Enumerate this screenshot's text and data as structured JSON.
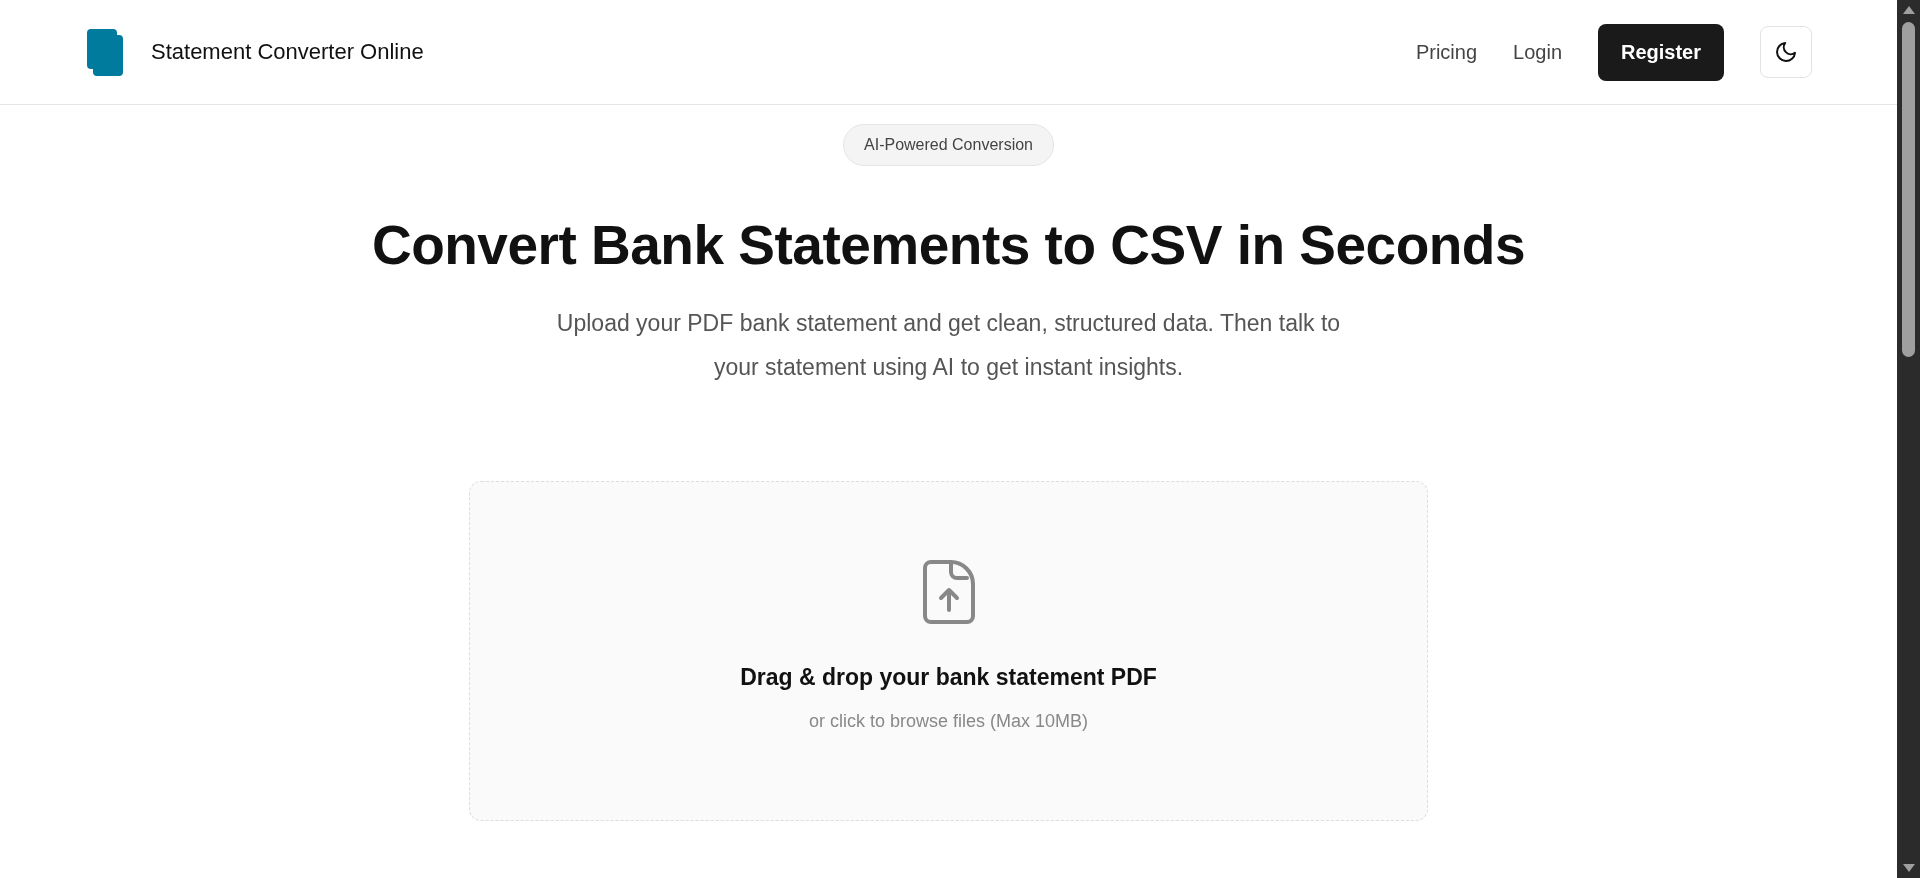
{
  "header": {
    "brand": "Statement Converter Online",
    "nav": [
      {
        "label": "Pricing",
        "kind": "link"
      },
      {
        "label": "Login",
        "kind": "link"
      },
      {
        "label": "Register",
        "kind": "primary"
      }
    ]
  },
  "hero": {
    "badge": "AI-Powered Conversion",
    "title": "Convert Bank Statements to CSV in Seconds",
    "subtitle": "Upload your PDF bank statement and get clean, structured data. Then talk to your statement using AI to get instant insights."
  },
  "upload": {
    "title": "Drag & drop your bank statement PDF",
    "hint": "or click to browse files (Max 10MB)"
  }
}
